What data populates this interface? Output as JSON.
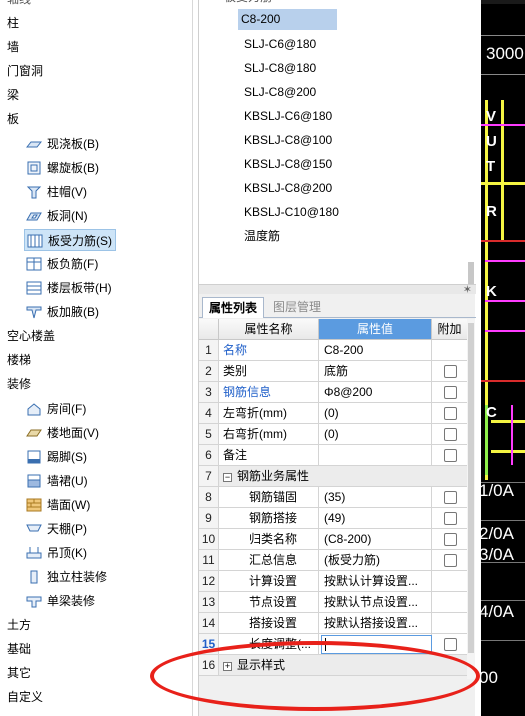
{
  "tree": {
    "top_cut": "轴线",
    "items_top": [
      "柱",
      "墙",
      "门窗洞",
      "梁",
      "板"
    ],
    "slab_children": [
      {
        "label": "现浇板(B)",
        "icon": "cast-slab-icon"
      },
      {
        "label": "螺旋板(B)",
        "icon": "spiral-slab-icon"
      },
      {
        "label": "柱帽(V)",
        "icon": "column-cap-icon"
      },
      {
        "label": "板洞(N)",
        "icon": "slab-hole-icon"
      },
      {
        "label": "板受力筋(S)",
        "icon": "slab-rebar-icon",
        "selected": true
      },
      {
        "label": "板负筋(F)",
        "icon": "negative-rebar-icon"
      },
      {
        "label": "楼层板带(H)",
        "icon": "floor-strip-icon"
      },
      {
        "label": "板加腋(B)",
        "icon": "slab-haunch-icon"
      }
    ],
    "items_mid": [
      "空心楼盖",
      "楼梯",
      "装修"
    ],
    "decor_children": [
      {
        "label": "房间(F)",
        "icon": "room-icon"
      },
      {
        "label": "楼地面(V)",
        "icon": "floor-icon"
      },
      {
        "label": "踢脚(S)",
        "icon": "skirting-icon"
      },
      {
        "label": "墙裙(U)",
        "icon": "dado-icon"
      },
      {
        "label": "墙面(W)",
        "icon": "wall-face-icon"
      },
      {
        "label": "天棚(P)",
        "icon": "ceiling-icon"
      },
      {
        "label": "吊顶(K)",
        "icon": "suspended-ceiling-icon"
      },
      {
        "label": "独立柱装修",
        "icon": "column-decor-icon"
      },
      {
        "label": "单梁装修",
        "icon": "beam-decor-icon"
      }
    ],
    "items_bottom": [
      "土方",
      "基础",
      "其它",
      "自定义"
    ]
  },
  "rebar_list": {
    "header_cut": "板受力筋",
    "items": [
      "C8-200",
      "SLJ-C6@180",
      "SLJ-C8@180",
      "SLJ-C8@200",
      "KBSLJ-C6@180",
      "KBSLJ-C8@100",
      "KBSLJ-C8@150",
      "KBSLJ-C8@200",
      "KBSLJ-C10@180",
      "温度筋"
    ],
    "selected_index": 0
  },
  "panel": {
    "pin_glyph": "✶",
    "tabs": [
      "属性列表",
      "图层管理"
    ],
    "columns": {
      "name": "属性名称",
      "value": "属性值",
      "extra": "附加"
    },
    "rows": [
      {
        "no": "1",
        "name": "名称",
        "value": "C8-200",
        "blue": true,
        "check": false
      },
      {
        "no": "2",
        "name": "类别",
        "value": "底筋",
        "check": true
      },
      {
        "no": "3",
        "name": "钢筋信息",
        "value": "Φ8@200",
        "blue": true,
        "check": true
      },
      {
        "no": "4",
        "name": "左弯折(mm)",
        "value": "(0)",
        "check": true
      },
      {
        "no": "5",
        "name": "右弯折(mm)",
        "value": "(0)",
        "check": true
      },
      {
        "no": "6",
        "name": "备注",
        "value": "",
        "check": true
      },
      {
        "no": "7",
        "name": "钢筋业务属性",
        "value": "",
        "group": true,
        "toggle": "−"
      },
      {
        "no": "8",
        "name": "钢筋锚固",
        "value": "(35)",
        "indent": true,
        "check": true
      },
      {
        "no": "9",
        "name": "钢筋搭接",
        "value": "(49)",
        "indent": true,
        "check": true
      },
      {
        "no": "10",
        "name": "归类名称",
        "value": "(C8-200)",
        "indent": true,
        "check": true
      },
      {
        "no": "11",
        "name": "汇总信息",
        "value": "(板受力筋)",
        "indent": true,
        "check": true
      },
      {
        "no": "12",
        "name": "计算设置",
        "value": "按默认计算设置...",
        "indent": true,
        "check": false
      },
      {
        "no": "13",
        "name": "节点设置",
        "value": "按默认节点设置...",
        "indent": true,
        "check": false
      },
      {
        "no": "14",
        "name": "搭接设置",
        "value": "按默认搭接设置...",
        "indent": true,
        "check": false
      },
      {
        "no": "15",
        "name": "长度调整(...",
        "value": "",
        "indent": true,
        "check": true,
        "editing": true
      },
      {
        "no": "16",
        "name": "显示样式",
        "value": "",
        "group": true,
        "toggle": "+"
      }
    ]
  },
  "canvas": {
    "labels": [
      "3000",
      "1/0A",
      "2/0A",
      "3/0A",
      "4/0A",
      "00"
    ],
    "axes": [
      "V",
      "U",
      "T",
      "R",
      "K",
      "C"
    ]
  },
  "colors": {
    "selection": "#b8d0ec",
    "value_header": "#5b9be0",
    "link_blue": "#1f5fc9",
    "annotation_red": "#e8211a"
  }
}
